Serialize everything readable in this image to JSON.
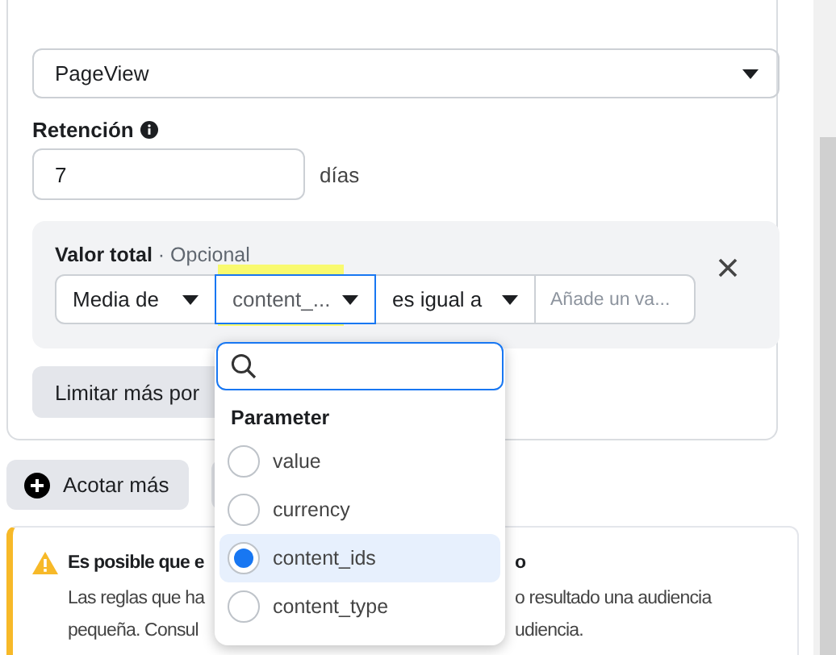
{
  "event_select": {
    "value": "PageView"
  },
  "retention": {
    "label": "Retención",
    "value": "7",
    "unit": "días"
  },
  "filter": {
    "label": "Valor total",
    "optional": "· Opcional",
    "controls": [
      {
        "kind": "select",
        "value": "Media de",
        "focused": false,
        "highlighted": false
      },
      {
        "kind": "select",
        "value": "content_...",
        "focused": true,
        "highlighted": true
      },
      {
        "kind": "select",
        "value": "es igual a",
        "focused": false,
        "highlighted": false
      },
      {
        "kind": "input",
        "placeholder": "Añade un va..."
      }
    ]
  },
  "refine_button": "Limitar más por",
  "dropdown": {
    "heading": "Parameter",
    "options": [
      {
        "label": "value",
        "selected": false
      },
      {
        "label": "currency",
        "selected": false
      },
      {
        "label": "content_ids",
        "selected": true
      },
      {
        "label": "content_type",
        "selected": false
      }
    ]
  },
  "add_button": "Acotar más",
  "warning": {
    "title_left": "Es posible que e",
    "title_right": "o",
    "lines": [
      {
        "left": "Las reglas que ha",
        "right": "o resultado una audiencia"
      },
      {
        "left": "pequeña. Consul",
        "right": "udiencia."
      }
    ]
  }
}
